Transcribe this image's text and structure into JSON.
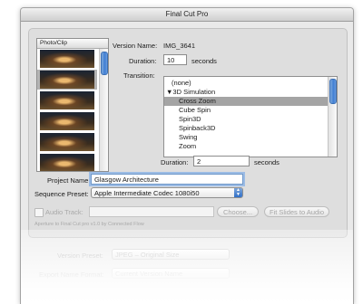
{
  "window": {
    "title": "Final Cut Pro"
  },
  "photo_list": {
    "header": "Photo/Clip",
    "thumbnails": [
      {
        "name": "thumb-1"
      },
      {
        "name": "thumb-2"
      },
      {
        "name": "thumb-3"
      },
      {
        "name": "thumb-4"
      },
      {
        "name": "thumb-5"
      },
      {
        "name": "thumb-6"
      }
    ],
    "selected_index": 1
  },
  "version": {
    "label": "Version Name:",
    "value": "IMG_3641"
  },
  "duration": {
    "label": "Duration:",
    "value": "10",
    "unit": "seconds"
  },
  "transition": {
    "label": "Transition:",
    "items": [
      "(none)",
      "▼3D Simulation",
      "Cross Zoom",
      "Cube Spin",
      "Spin3D",
      "Spinback3D",
      "Swing",
      "Zoom"
    ],
    "selected": "Cross Zoom"
  },
  "transition_duration": {
    "label": "Duration:",
    "value": "2",
    "unit": "seconds"
  },
  "project_name": {
    "label": "Project Name:",
    "value": "Glasgow Architecture"
  },
  "sequence_preset": {
    "label": "Sequence Preset:",
    "value": "Apple Intermediate Codec 1080i50"
  },
  "audio_track": {
    "label": "Audio Track:",
    "choose_label": "Choose...",
    "fit_label": "Fit Slides to Audio"
  },
  "footer_note": "Aperture to Final Cut pro v1.0 by Connected Flow",
  "version_preset": {
    "label": "Version Preset:",
    "value": "JPEG – Original Size"
  },
  "export_name_format": {
    "label": "Export Name Format:",
    "value": "Current Version Name"
  },
  "colors": {
    "accent": "#3f7ed3",
    "selection": "#a4a4a4",
    "focus_ring": "#9cbce5"
  }
}
